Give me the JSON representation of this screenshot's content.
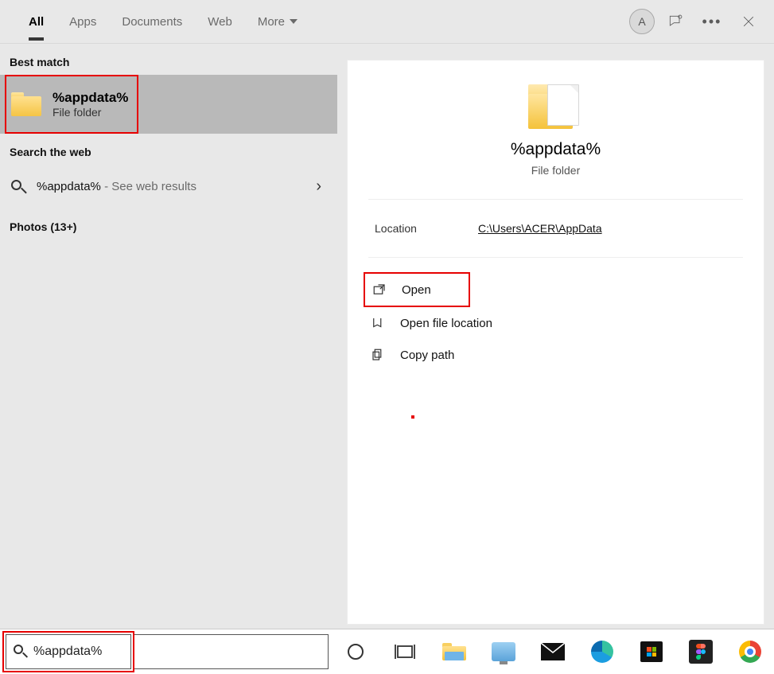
{
  "tabs": {
    "all": "All",
    "apps": "Apps",
    "documents": "Documents",
    "web": "Web",
    "more": "More"
  },
  "user": {
    "initial": "A"
  },
  "sections": {
    "best_match": "Best match",
    "search_web": "Search the web",
    "photos": "Photos (13+)"
  },
  "best_match_item": {
    "title": "%appdata%",
    "subtitle": "File folder"
  },
  "web_result": {
    "text": "%appdata%",
    "suffix": " - See web results"
  },
  "detail": {
    "title": "%appdata%",
    "subtitle": "File folder",
    "location_label": "Location",
    "location_value": "C:\\Users\\ACER\\AppData",
    "actions": {
      "open": "Open",
      "open_location": "Open file location",
      "copy_path": "Copy path"
    }
  },
  "searchbox": {
    "value": "%appdata%"
  }
}
